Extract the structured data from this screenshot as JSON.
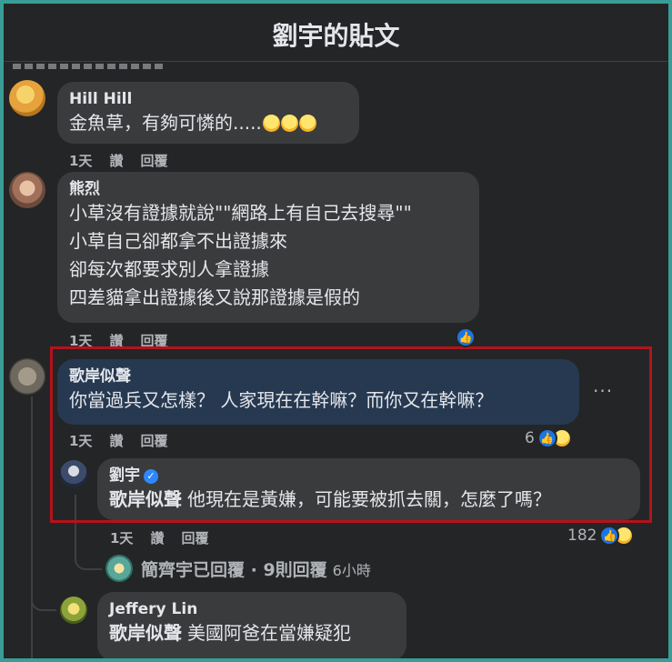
{
  "header": {
    "title": "劉宇的貼文"
  },
  "actions_labels": {
    "time": "1天",
    "like": "讚",
    "reply": "回覆"
  },
  "comments": [
    {
      "name": "Hill Hill",
      "text": "金魚草，有夠可憐的....."
    },
    {
      "name": "熊烈",
      "lines": [
        "小草沒有證據就說\"\"網路上有自己去搜尋\"\"",
        "小草自己卻都拿不出證據來",
        "卻每次都要求別人拿證據",
        "四差貓拿出證據後又說那證據是假的"
      ]
    },
    {
      "name": "歌岸似聲",
      "text": "你當過兵又怎樣？ 人家現在在幹嘛？而你又在幹嘛？",
      "reaction_count": "6"
    },
    {
      "name": "劉宇",
      "tag": "歌岸似聲",
      "text": "他現在是黃嫌，可能要被抓去關，怎麼了嗎？",
      "reaction_count": "182"
    },
    {
      "name": "Jeffery Lin",
      "tag": "歌岸似聲",
      "text": "美國阿爸在當嫌疑犯"
    }
  ],
  "replies_summary": {
    "text": "簡齊宇已回覆 · 9則回覆",
    "time": "6小時"
  },
  "more_label": "···",
  "icons": {
    "like": "like-icon",
    "haha": "haha-icon",
    "verified": "verified-icon"
  },
  "colors": {
    "highlight": "#b5121b",
    "like": "#1b74e4",
    "background": "#242526",
    "bubble": "#3a3b3c",
    "selected_bubble": "#263951"
  }
}
